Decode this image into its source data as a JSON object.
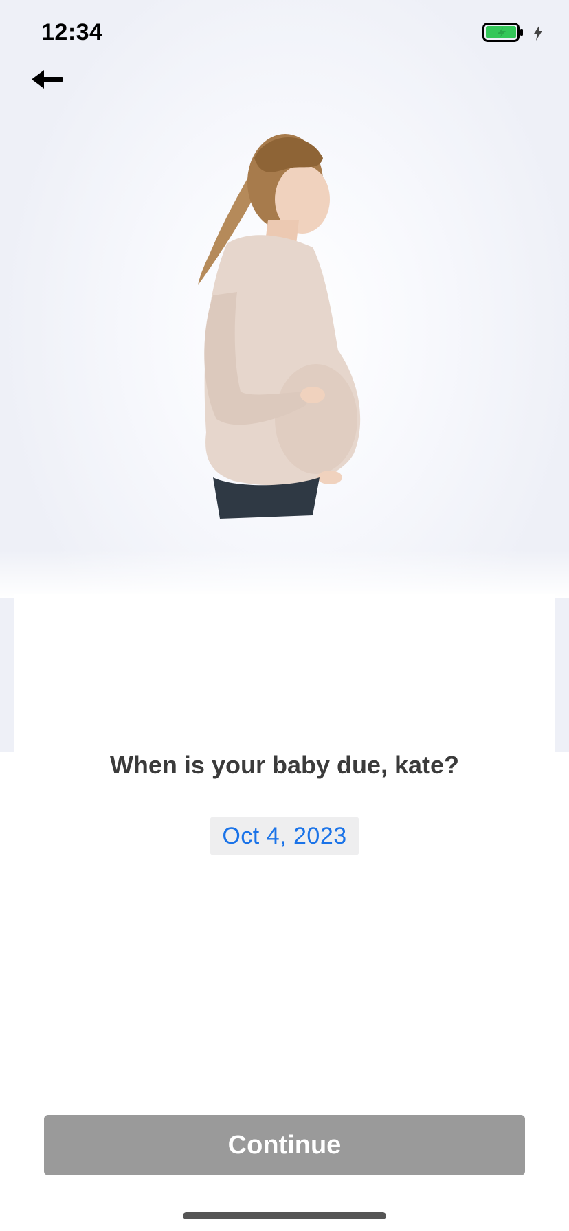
{
  "status_bar": {
    "time": "12:34",
    "battery_icon": "battery-charging-icon",
    "battery_level": 1.0,
    "battery_color": "#34c759",
    "charging_icon": "bolt-icon"
  },
  "nav": {
    "back_icon": "arrow-left-icon"
  },
  "hero": {
    "image": "pregnant-woman-photo"
  },
  "main": {
    "question": "When is your baby due, kate?",
    "due_date": "Oct 4, 2023"
  },
  "footer": {
    "continue_label": "Continue",
    "continue_color": "#9a9a9a"
  },
  "colors": {
    "accent": "#1a73e8",
    "text": "#3b3b3b"
  }
}
